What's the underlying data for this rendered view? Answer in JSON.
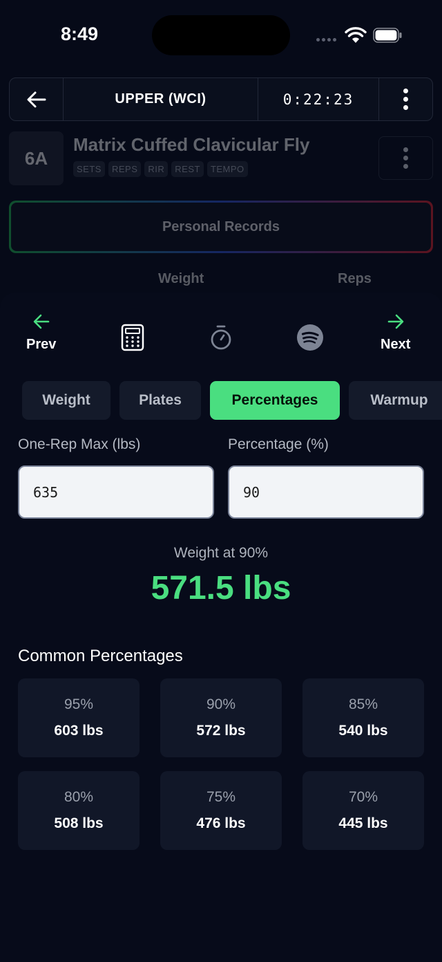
{
  "status": {
    "time": "8:49"
  },
  "header": {
    "title": "UPPER (WCI)",
    "timer": "0:22:23"
  },
  "exercise": {
    "badge": "6A",
    "name": "Matrix Cuffed Clavicular Fly",
    "tags": [
      "SETS",
      "REPS",
      "RIR",
      "REST",
      "TEMPO"
    ]
  },
  "records": {
    "label": "Personal Records",
    "col_weight": "Weight",
    "col_reps": "Reps"
  },
  "toolbar": {
    "prev": "Prev",
    "next": "Next",
    "accent": "#4ade80"
  },
  "tabs": [
    {
      "label": "Weight"
    },
    {
      "label": "Plates"
    },
    {
      "label": "Percentages"
    },
    {
      "label": "Warmup"
    }
  ],
  "calculator": {
    "orm_label": "One-Rep Max (lbs)",
    "orm_value": "635",
    "pct_label": "Percentage (%)",
    "pct_value": "90",
    "result_label": "Weight at 90%",
    "result_value": "571.5 lbs"
  },
  "common": {
    "title": "Common Percentages",
    "items": [
      {
        "pct": "95%",
        "weight": "603 lbs"
      },
      {
        "pct": "90%",
        "weight": "572 lbs"
      },
      {
        "pct": "85%",
        "weight": "540 lbs"
      },
      {
        "pct": "80%",
        "weight": "508 lbs"
      },
      {
        "pct": "75%",
        "weight": "476 lbs"
      },
      {
        "pct": "70%",
        "weight": "445 lbs"
      }
    ]
  }
}
